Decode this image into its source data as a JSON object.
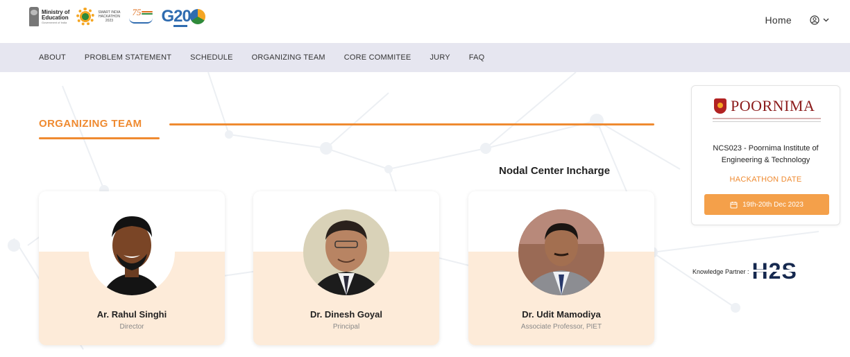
{
  "header": {
    "logos": {
      "moe_line1": "Ministry of",
      "moe_line2": "Education",
      "moe_line3": "Government of India",
      "sih_text": "SMART INDIA HACKATHON 2023",
      "g20_text": "G20"
    },
    "home_label": "Home",
    "user_icon": "user-circle-icon",
    "dropdown_icon": "chevron-down-icon"
  },
  "menu": {
    "items": [
      {
        "label": "ABOUT"
      },
      {
        "label": "PROBLEM STATEMENT"
      },
      {
        "label": "SCHEDULE"
      },
      {
        "label": "ORGANIZING TEAM"
      },
      {
        "label": "CORE COMMITEE"
      },
      {
        "label": "JURY"
      },
      {
        "label": "FAQ"
      }
    ]
  },
  "section": {
    "title": "ORGANIZING TEAM",
    "nodal_heading": "Nodal Center Incharge"
  },
  "team": [
    {
      "name": "Ar. Rahul Singhi",
      "role": "Director"
    },
    {
      "name": "Dr. Dinesh Goyal",
      "role": "Principal"
    },
    {
      "name": "Dr. Udit Mamodiya",
      "role": "Associate Professor, PIET"
    }
  ],
  "info_panel": {
    "logo_text": "POORNIMA",
    "center_name": "NCS023 - Poornima Institute of Engineering & Technology",
    "hackathon_label": "HACKATHON DATE",
    "date": "19th-20th Dec 2023",
    "calendar_icon": "calendar-icon"
  },
  "partner": {
    "label": "Knowledge Partner :",
    "logo_text": "H2S"
  },
  "colors": {
    "accent": "#ef8a30",
    "menubar_bg": "#e6e6f0",
    "card_band": "#fdebd9",
    "date_button": "#f4a04a",
    "brand_maroon": "#8b1a1a"
  }
}
